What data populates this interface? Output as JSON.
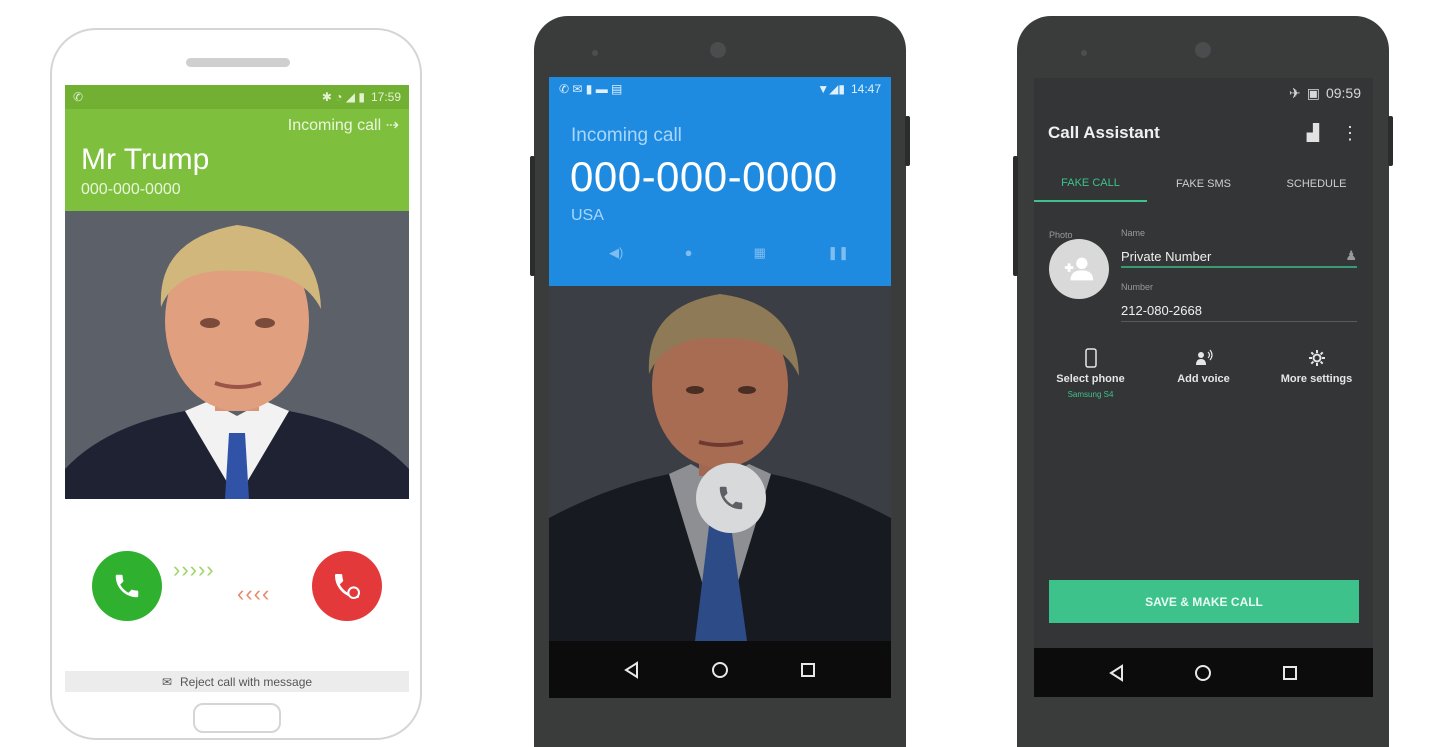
{
  "phone1": {
    "status_time": "17:59",
    "incoming_label": "Incoming call",
    "caller_name": "Mr Trump",
    "caller_number": "000-000-0000",
    "accept_icon": "phone-answer-icon",
    "reject_icon": "phone-hangup-icon",
    "arrows_right": "›››››",
    "arrows_left": "‹‹‹‹",
    "reject_message": "Reject call with message",
    "colors": {
      "header": "#7ec03d",
      "accept": "#2fb02f",
      "reject": "#e4393a"
    }
  },
  "phone2": {
    "status_time": "14:47",
    "incoming_label": "Incoming call",
    "number": "000-000-0000",
    "country": "USA",
    "answer_icon": "phone-answer-icon",
    "colors": {
      "header": "#1f8be0"
    }
  },
  "phone3": {
    "status_time": "09:59",
    "app_title": "Call Assistant",
    "tabs": [
      {
        "label": "FAKE CALL",
        "active": true
      },
      {
        "label": "FAKE SMS",
        "active": false
      },
      {
        "label": "SCHEDULE",
        "active": false
      }
    ],
    "photo_label": "Photo",
    "name_label": "Name",
    "name_value": "Private Number",
    "number_label": "Number",
    "number_value": "212-080-2668",
    "options": [
      {
        "label": "Select phone",
        "sub": "Samsung S4",
        "icon": "phone-device-icon"
      },
      {
        "label": "Add voice",
        "sub": "",
        "icon": "voice-icon"
      },
      {
        "label": "More settings",
        "sub": "",
        "icon": "gear-icon"
      }
    ],
    "save_button": "SAVE & MAKE CALL",
    "colors": {
      "accent": "#3ec28c"
    }
  }
}
